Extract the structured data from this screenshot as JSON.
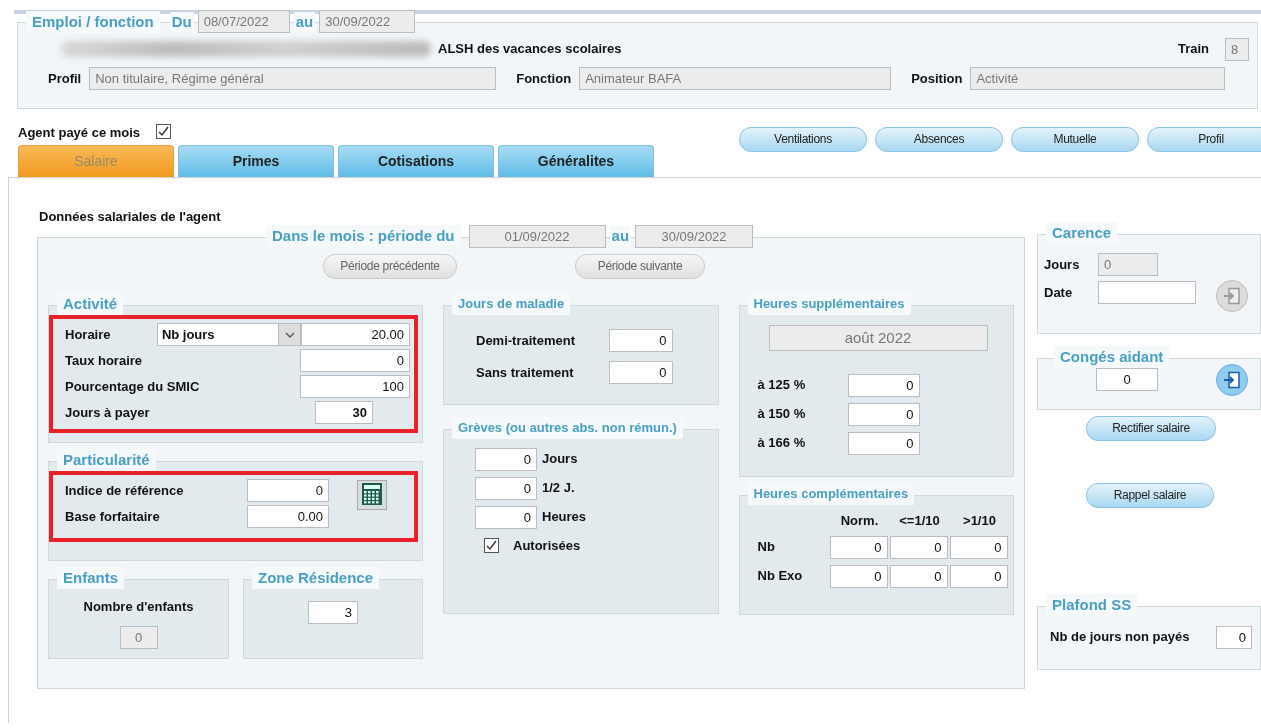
{
  "header": {
    "legend": "Emploi / fonction",
    "from_label": "Du",
    "from": "08/07/2022",
    "to_label": "au",
    "to": "30/09/2022",
    "service": "ALSH des vacances scolaires",
    "train_label": "Train",
    "train": "8",
    "fields": [
      {
        "label": "Profil",
        "value": "Non titulaire, Régime général"
      },
      {
        "label": "Fonction",
        "value": "Animateur BAFA"
      },
      {
        "label": "Position",
        "value": "Activité"
      }
    ]
  },
  "agent_paid": {
    "label": "Agent payé ce mois",
    "checked": true
  },
  "action_buttons": [
    "Ventilations",
    "Absences",
    "Mutuelle",
    "Profil"
  ],
  "tabs": [
    {
      "label": "Salaire",
      "selected": true
    },
    {
      "label": "Primes",
      "selected": false
    },
    {
      "label": "Cotisations",
      "selected": false
    },
    {
      "label": "Généralites",
      "selected": false
    }
  ],
  "section_title": "Données salariales de l'agent",
  "period": {
    "legend": "Dans le mois : période du",
    "from": "01/09/2022",
    "to_label": "au",
    "to": "30/09/2022",
    "prev": "Période précédente",
    "next": "Période suivante"
  },
  "activite": {
    "legend": "Activité",
    "highlighted": true,
    "horaire_label": "Horaire",
    "horaire_mode": "Nb jours",
    "horaire_value": "20.00",
    "rows": [
      {
        "label": "Taux horaire",
        "value": "0",
        "kind": "wide"
      },
      {
        "label": "Pourcentage du SMIC",
        "value": "100",
        "kind": "wide"
      },
      {
        "label": "Jours à payer",
        "value": "30",
        "kind": "short"
      }
    ]
  },
  "particularite": {
    "legend": "Particularité",
    "highlighted": true,
    "rows": [
      {
        "label": "Indice de référence",
        "value": "0"
      },
      {
        "label": "Base forfaitaire",
        "value": "0.00"
      }
    ]
  },
  "enfants": {
    "legend": "Enfants",
    "label": "Nombre d'enfants",
    "value": "0"
  },
  "zone_residence": {
    "legend": "Zone Résidence",
    "value": "3"
  },
  "jours_maladie": {
    "legend": "Jours de maladie",
    "rows": [
      {
        "label": "Demi-traitement",
        "value": "0"
      },
      {
        "label": "Sans traitement",
        "value": "0"
      }
    ]
  },
  "greves": {
    "legend": "Grèves (ou autres abs. non rémun.)",
    "rows": [
      {
        "value": "0",
        "label": "Jours"
      },
      {
        "value": "0",
        "label": "1/2 J."
      },
      {
        "value": "0",
        "label": "Heures"
      }
    ],
    "authorized": {
      "label": "Autorisées",
      "checked": true
    }
  },
  "heures_sup": {
    "legend": "Heures supplémentaires",
    "month": "août 2022",
    "rows": [
      {
        "label": "à 125 %",
        "value": "0"
      },
      {
        "label": "à 150 %",
        "value": "0"
      },
      {
        "label": "à 166 %",
        "value": "0"
      }
    ]
  },
  "heures_comp": {
    "legend": "Heures complémentaires",
    "columns": [
      "Norm.",
      "<=1/10",
      ">1/10"
    ],
    "rows": [
      {
        "label": "Nb",
        "values": [
          "0",
          "0",
          "0"
        ]
      },
      {
        "label": "Nb Exo",
        "values": [
          "0",
          "0",
          "0"
        ]
      }
    ]
  },
  "carence": {
    "legend": "Carence",
    "jours_label": "Jours",
    "jours": "0",
    "date_label": "Date",
    "disabled": true
  },
  "conges_aidant": {
    "legend": "Congés aidant",
    "value": "0",
    "disabled": false
  },
  "side_buttons": [
    "Rectifier salaire",
    "Rappel salaire"
  ],
  "plafond_ss": {
    "legend": "Plafond SS",
    "label": "Nb de jours non payés",
    "value": "0"
  }
}
